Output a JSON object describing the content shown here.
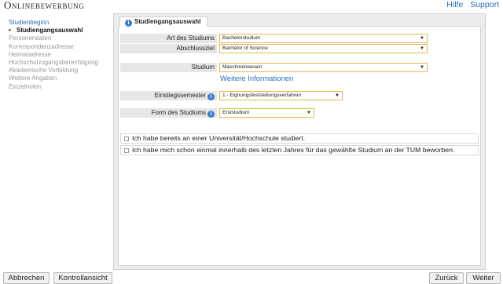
{
  "app": {
    "title": "Onlinebewerbung"
  },
  "toplinks": {
    "help": "Hilfe",
    "support": "Support"
  },
  "sidebar": {
    "items": [
      {
        "label": "Studienbeginn"
      },
      {
        "label": "Studiengangsauswahl",
        "bullet": "•"
      },
      {
        "label": "Personendaten"
      },
      {
        "label": "Korrespondenzadresse"
      },
      {
        "label": "Heimatadresse"
      },
      {
        "label": "Hochschulzugangsberechtigung"
      },
      {
        "label": "Akademische Vorbildung"
      },
      {
        "label": "Weitere Angaben"
      },
      {
        "label": "Einzelnoten"
      }
    ]
  },
  "panel": {
    "tab_label": "Studiengangsauswahl"
  },
  "form": {
    "art": {
      "label": "Art des Studiums",
      "value": "Bachelorstudium"
    },
    "abschluss": {
      "label": "Abschlussziel",
      "value": "Bachelor of Science"
    },
    "studium": {
      "label": "Studium",
      "value": "Maschinenwesen"
    },
    "more_info": "Weitere Informationen",
    "einstieg": {
      "label": "Einstiegssemester",
      "value": "1 - Eignungsfeststellungsverfahren"
    },
    "form": {
      "label": "Form des Studiums",
      "value": "Erststudium"
    },
    "check1": "Ich habe bereits an einer Universität/Hochschule studiert.",
    "check2": "Ich habe mich schon einmal innerhalb des letzten Jahres für das gewählte Studium an der TUM beworben."
  },
  "buttons": {
    "cancel": "Abbrechen",
    "overview": "Kontrollansicht",
    "back": "Zurück",
    "next": "Weiter"
  },
  "icons": {
    "dropdown": "chevron-down-icon",
    "info": "info-icon",
    "checkbox": "checkbox-icon"
  },
  "colors": {
    "accent_link": "#2a6ebb",
    "select_border": "#e5b84c",
    "info_icon": "#3b7cc4"
  }
}
